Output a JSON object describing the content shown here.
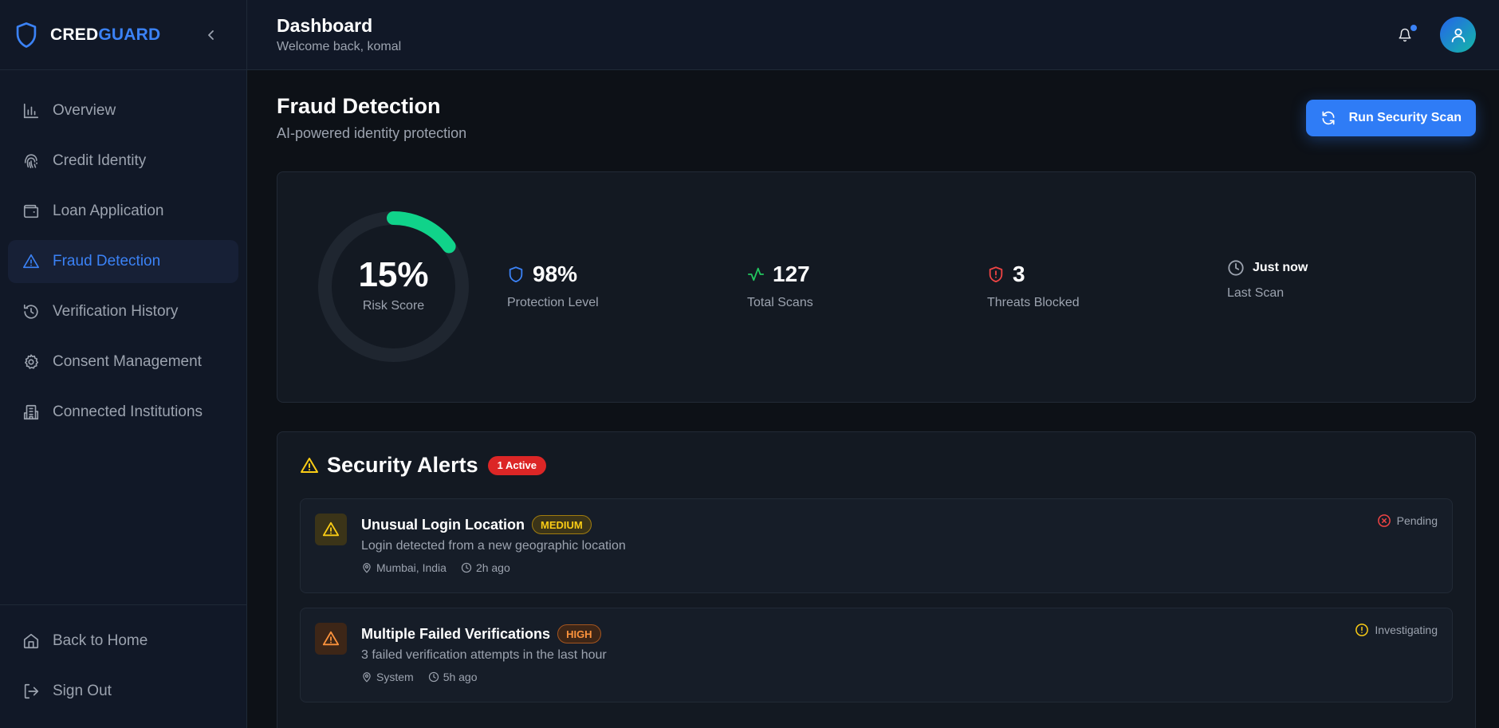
{
  "brand": {
    "part1": "CRED",
    "part2": "GUARD"
  },
  "sidebar": {
    "items": [
      {
        "label": "Overview",
        "icon": "bar-chart-icon"
      },
      {
        "label": "Credit Identity",
        "icon": "fingerprint-icon"
      },
      {
        "label": "Loan Application",
        "icon": "wallet-icon"
      },
      {
        "label": "Fraud Detection",
        "icon": "alert-triangle-icon",
        "active": true
      },
      {
        "label": "Verification History",
        "icon": "history-icon"
      },
      {
        "label": "Consent Management",
        "icon": "gear-icon"
      },
      {
        "label": "Connected Institutions",
        "icon": "building-icon"
      }
    ],
    "bottom": [
      {
        "label": "Back to Home",
        "icon": "home-icon"
      },
      {
        "label": "Sign Out",
        "icon": "sign-out-icon"
      }
    ]
  },
  "header": {
    "title": "Dashboard",
    "subtitle": "Welcome back, komal"
  },
  "page": {
    "title": "Fraud Detection",
    "subtitle": "AI-powered identity protection",
    "scan_button": "Run Security Scan"
  },
  "risk": {
    "value": "15%",
    "label": "Risk Score",
    "fraction": 0.15
  },
  "stats": [
    {
      "value": "98%",
      "label": "Protection Level",
      "icon": "shield-icon",
      "color": "#3b82f6"
    },
    {
      "value": "127",
      "label": "Total Scans",
      "icon": "activity-icon",
      "color": "#22c55e"
    },
    {
      "value": "3",
      "label": "Threats Blocked",
      "icon": "shield-alert-icon",
      "color": "#ef4444"
    },
    {
      "value": "Just now",
      "label": "Last Scan",
      "icon": "clock-icon",
      "color": "#9ca3af"
    }
  ],
  "alerts": {
    "title": "Security Alerts",
    "badge": "1 Active",
    "items": [
      {
        "title": "Unusual Login Location",
        "severity": "MEDIUM",
        "description": "Login detected from a new geographic location",
        "location": "Mumbai, India",
        "time": "2h ago",
        "status": "Pending"
      },
      {
        "title": "Multiple Failed Verifications",
        "severity": "HIGH",
        "description": "3 failed verification attempts in the last hour",
        "location": "System",
        "time": "5h ago",
        "status": "Investigating"
      }
    ]
  },
  "colors": {
    "accent": "#3b82f6",
    "gauge": "#10d38a",
    "danger": "#dc2626",
    "warning": "#facc15",
    "orange": "#fb923c"
  }
}
